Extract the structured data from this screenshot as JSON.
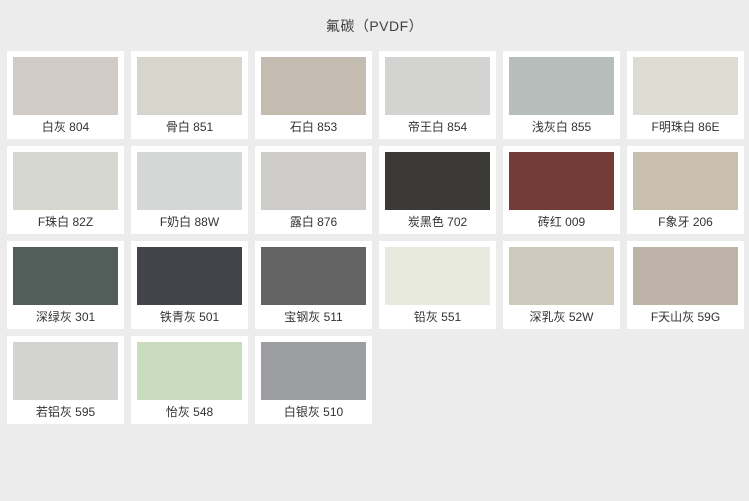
{
  "header": {
    "title": "氟碳（PVDF）"
  },
  "palette": {
    "background_color": "#ececec",
    "card_color": "#ffffff",
    "text_color": "#333333"
  },
  "swatches": [
    {
      "name": "白灰 804",
      "color": "#d0ccc5"
    },
    {
      "name": "骨白 851",
      "color": "#d6d6cd"
    },
    {
      "name": "石白 853",
      "color": "#c4bcb0"
    },
    {
      "name": "帝王白 854",
      "color": "#d3d3d1"
    },
    {
      "name": "浅灰白 855",
      "color": "#b7bdba"
    },
    {
      "name": "F明珠白 86E",
      "color": "#dcdcd2"
    },
    {
      "name": "F珠白 82Z",
      "color": "#d6d8cf"
    },
    {
      "name": "F奶白 88W",
      "color": "#d3d7d5"
    },
    {
      "name": "露白 876",
      "color": "#cdccc9"
    },
    {
      "name": "炭黑色 702",
      "color": "#3a3936"
    },
    {
      "name": "砖红 009",
      "color": "#743c39"
    },
    {
      "name": "F象牙 206",
      "color": "#c8bfae"
    },
    {
      "name": "深绿灰 301",
      "color": "#525e5a"
    },
    {
      "name": "铁青灰 501",
      "color": "#414448"
    },
    {
      "name": "宝钢灰 511",
      "color": "#636363"
    },
    {
      "name": "铅灰 551",
      "color": "#e8eade"
    },
    {
      "name": "深乳灰 52W",
      "color": "#cdc9bd"
    },
    {
      "name": "F天山灰 59G",
      "color": "#bdb3a9"
    },
    {
      "name": "若铝灰 595",
      "color": "#d3d3cf"
    },
    {
      "name": "怡灰 548",
      "color": "#c9dcc0"
    },
    {
      "name": "白银灰 510",
      "color": "#9c9ea1"
    }
  ]
}
